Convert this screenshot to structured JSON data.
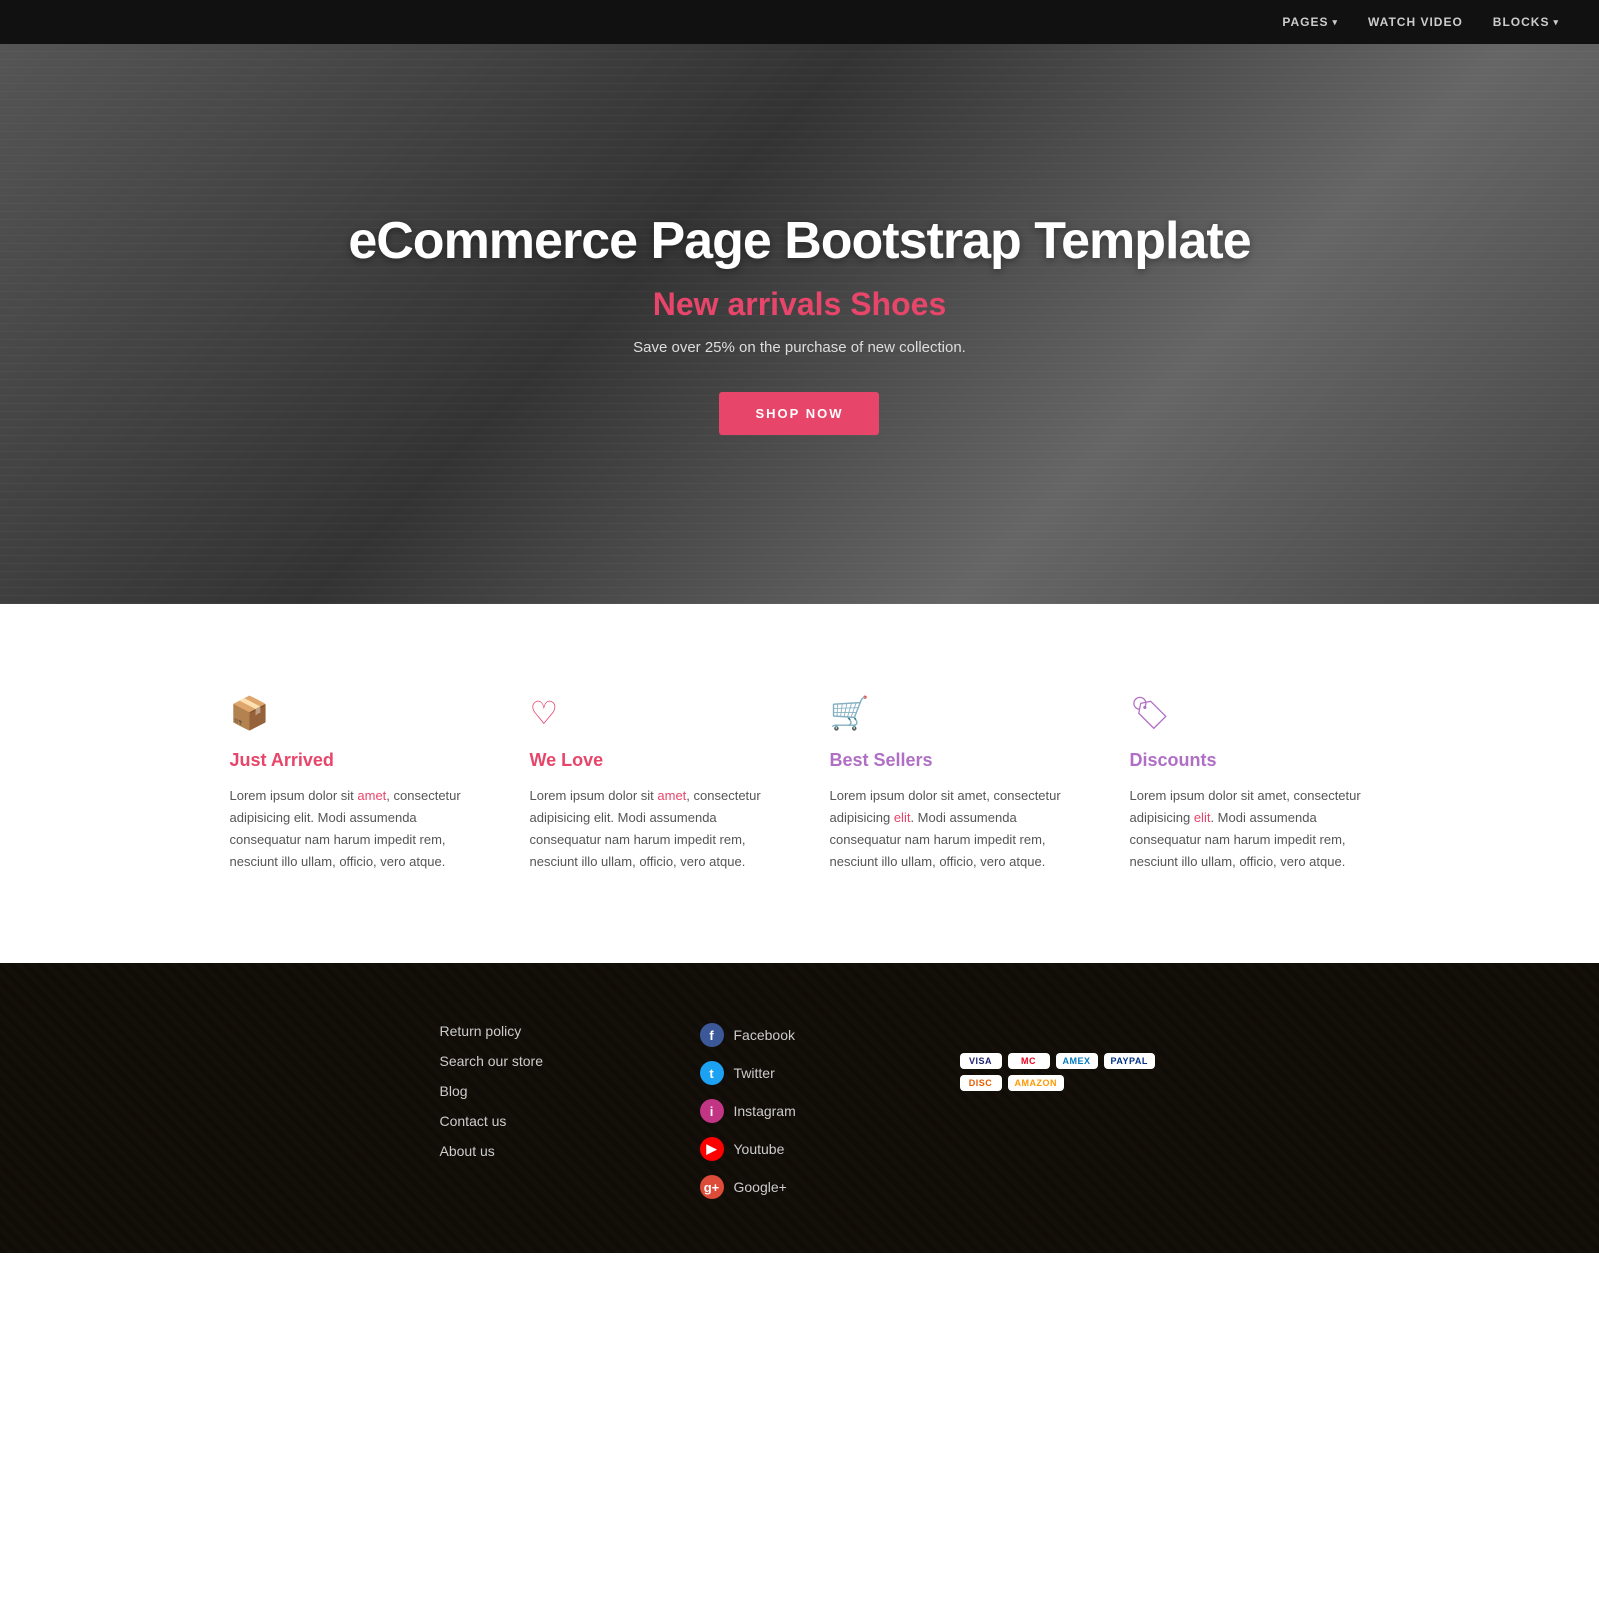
{
  "navbar": {
    "items": [
      {
        "label": "PAGES",
        "hasDropdown": true
      },
      {
        "label": "WATCH VIDEO",
        "hasDropdown": false
      },
      {
        "label": "BLOCKS",
        "hasDropdown": true
      }
    ]
  },
  "hero": {
    "title": "eCommerce Page Bootstrap Template",
    "subtitle_prefix": "New arrivals ",
    "subtitle_highlight": "Shoes",
    "tagline": "Save over 25% on the purchase of new collection.",
    "cta_label": "SHOP NOW"
  },
  "features": [
    {
      "id": "just-arrived",
      "icon": "📦",
      "title": "Just Arrived",
      "color": "pink",
      "text": "Lorem ipsum dolor sit amet, consectetur adipisicing elit. Modi assumenda consequatur nam harum impedit rem, nesciunt illo ullam, officio, vero atque."
    },
    {
      "id": "we-love",
      "icon": "♡",
      "title": "We Love",
      "color": "pink",
      "text": "Lorem ipsum dolor sit amet, consectetur adipisicing elit. Modi assumenda consequatur nam harum impedit rem, nesciunt illo ullam, officio, vero atque."
    },
    {
      "id": "best-sellers",
      "icon": "🛒",
      "title": "Best Sellers",
      "color": "purple",
      "text": "Lorem ipsum dolor sit amet, consectetur adipisicing elit. Modi assumenda consequatur nam harum impedit rem, nesciunt illo ullam, officio, vero atque."
    },
    {
      "id": "discounts",
      "icon": "🏷",
      "title": "Discounts",
      "color": "purple",
      "text": "Lorem ipsum dolor sit amet, consectetur adipisicing elit. Modi assumenda consequatur nam harum impedit rem, nesciunt illo ullam, officio, vero atque."
    }
  ],
  "footer": {
    "links": [
      {
        "label": "Return policy"
      },
      {
        "label": "Search our store"
      },
      {
        "label": "Blog"
      },
      {
        "label": "Contact us"
      },
      {
        "label": "About us"
      }
    ],
    "social": [
      {
        "label": "Facebook",
        "icon": "f",
        "class": "fb"
      },
      {
        "label": "Twitter",
        "icon": "t",
        "class": "tw"
      },
      {
        "label": "Instagram",
        "icon": "i",
        "class": "ig"
      },
      {
        "label": "Youtube",
        "icon": "▶",
        "class": "yt"
      },
      {
        "label": "Google+",
        "icon": "g+",
        "class": "gp"
      }
    ],
    "payments": [
      {
        "label": "VISA",
        "class": "visa"
      },
      {
        "label": "MC",
        "class": "mc"
      },
      {
        "label": "AMEX",
        "class": "amex"
      },
      {
        "label": "PayPal",
        "class": "paypal"
      },
      {
        "label": "DISC",
        "class": "discover"
      },
      {
        "label": "amazon",
        "class": "amazon"
      }
    ]
  }
}
